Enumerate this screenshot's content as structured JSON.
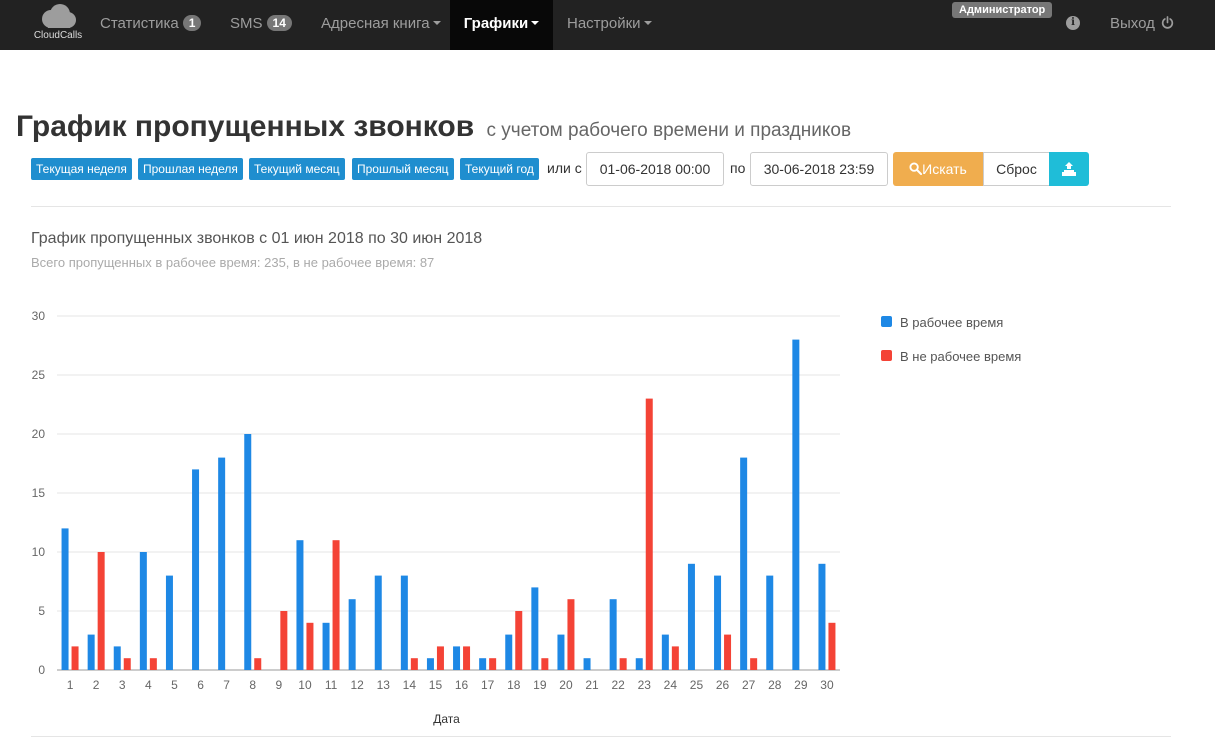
{
  "nav": {
    "brand": "CloudCalls",
    "items": [
      {
        "label": "Статистика",
        "badge": "1"
      },
      {
        "label": "SMS",
        "badge": "14"
      },
      {
        "label": "Адресная книга"
      },
      {
        "label": "Графики"
      },
      {
        "label": "Настройки"
      }
    ],
    "admin": "Администратор",
    "info_icon": "i",
    "logout": "Выход"
  },
  "page": {
    "title": "График пропущенных звонков",
    "subtitle": "с учетом рабочего времени и праздников"
  },
  "filters": {
    "periods": [
      "Текущая неделя",
      "Прошлая неделя",
      "Текущий месяц",
      "Прошлый месяц",
      "Текущий год"
    ],
    "or_from": "или с",
    "to": "по",
    "date_from": "01-06-2018 00:00",
    "date_to": "30-06-2018 23:59",
    "search": "Искать",
    "reset": "Сброс"
  },
  "chart_header": {
    "title": "График пропущенных звонков с  01 июн 2018 по 30 июн 2018",
    "subtitle": "Всего пропущенных в рабочее время: 235, в не рабочее время: 87"
  },
  "colors": {
    "work": "#1e88e5",
    "nonwork": "#f44336",
    "navbar": "#222222",
    "period_button": "#1f8ecf",
    "search_button": "#f0ad4e",
    "export_button": "#1fbdd8"
  },
  "chart_data": {
    "type": "bar",
    "xlabel": "Дата",
    "ylim": [
      0,
      30
    ],
    "yticks": [
      0,
      5,
      10,
      15,
      20,
      25,
      30
    ],
    "grid": true,
    "legend_position": "right",
    "categories": [
      "1",
      "2",
      "3",
      "4",
      "5",
      "6",
      "7",
      "8",
      "9",
      "10",
      "11",
      "12",
      "13",
      "14",
      "15",
      "16",
      "17",
      "18",
      "19",
      "20",
      "21",
      "22",
      "23",
      "24",
      "25",
      "26",
      "27",
      "28",
      "29",
      "30"
    ],
    "series": [
      {
        "name": "В рабочее время",
        "values": [
          12,
          3,
          2,
          10,
          8,
          17,
          18,
          20,
          0,
          11,
          4,
          6,
          8,
          8,
          1,
          2,
          1,
          3,
          7,
          3,
          1,
          6,
          1,
          3,
          9,
          8,
          18,
          8,
          28,
          9
        ]
      },
      {
        "name": "В не рабочее время",
        "values": [
          2,
          10,
          1,
          1,
          0,
          0,
          0,
          1,
          5,
          4,
          11,
          0,
          0,
          1,
          2,
          2,
          1,
          5,
          1,
          6,
          0,
          1,
          23,
          2,
          0,
          3,
          1,
          0,
          0,
          4
        ]
      }
    ]
  }
}
